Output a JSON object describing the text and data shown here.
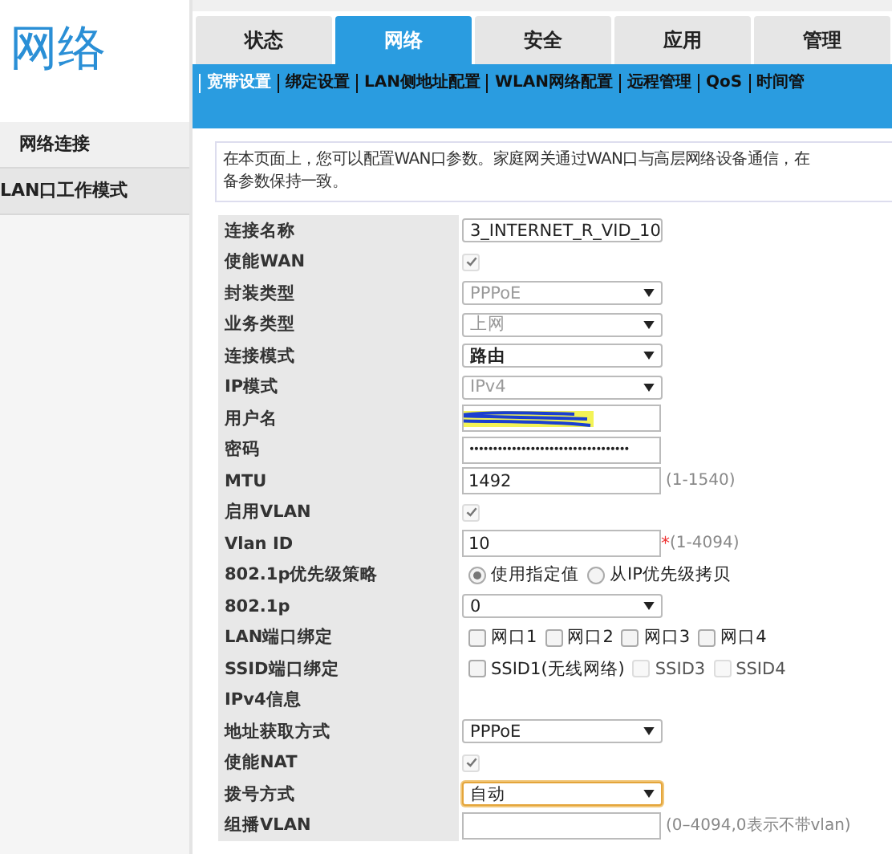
{
  "sidebar": {
    "title": "网络",
    "items": [
      {
        "label": "网络连接",
        "selected": true
      },
      {
        "label": "LAN口工作模式",
        "selected": false
      }
    ]
  },
  "tabs": [
    {
      "label": "状态",
      "selected": false
    },
    {
      "label": "网络",
      "selected": true
    },
    {
      "label": "安全",
      "selected": false
    },
    {
      "label": "应用",
      "selected": false
    },
    {
      "label": "管理",
      "selected": false
    }
  ],
  "subnav": [
    {
      "label": "宽带设置",
      "selected": true
    },
    {
      "label": "绑定设置",
      "selected": false
    },
    {
      "label": "LAN侧地址配置",
      "selected": false
    },
    {
      "label": "WLAN网络配置",
      "selected": false
    },
    {
      "label": "远程管理",
      "selected": false
    },
    {
      "label": "QoS",
      "selected": false
    },
    {
      "label": "时间管",
      "selected": false
    }
  ],
  "description": [
    "在本页面上，您可以配置WAN口参数。家庭网关通过WAN口与高层网络设备通信，在",
    "备参数保持一致。"
  ],
  "form": [
    {
      "label": "连接名称",
      "kind": "select",
      "value": "3_INTERNET_R_VID_10",
      "disabled": false
    },
    {
      "label": "使能WAN",
      "kind": "checkbox",
      "checked": true,
      "disabled": true
    },
    {
      "label": "封装类型",
      "kind": "select",
      "value": "PPPoE",
      "disabled": true
    },
    {
      "label": "业务类型",
      "kind": "select",
      "value": "上网",
      "disabled": true
    },
    {
      "label": "连接模式",
      "kind": "select",
      "value": "路由",
      "disabled": false
    },
    {
      "label": "IP模式",
      "kind": "select",
      "value": "IPv4",
      "disabled": true
    },
    {
      "label": "用户名",
      "kind": "text",
      "redacted": true
    },
    {
      "label": "密码",
      "kind": "text",
      "value": "••••••••••••••••••••••••••••••••••"
    },
    {
      "label": "MTU",
      "kind": "text",
      "value": "1492",
      "hint": "(1-1540)"
    },
    {
      "label": "启用VLAN",
      "kind": "checkbox",
      "checked": true,
      "disabled": true
    },
    {
      "label": "Vlan ID",
      "kind": "text",
      "value": "10",
      "required_mark": "*",
      "hint": "(1-4094)"
    },
    {
      "label": "802.1p优先级策略",
      "kind": "radio",
      "options": [
        {
          "label": "使用指定值",
          "selected": true
        },
        {
          "label": "从IP优先级拷贝",
          "selected": false
        }
      ]
    },
    {
      "label": "802.1p",
      "kind": "select",
      "value": "0",
      "disabled": false
    },
    {
      "label": "LAN端口绑定",
      "kind": "checkboxes",
      "options": [
        {
          "label": "网口1",
          "checked": false,
          "disabled": false
        },
        {
          "label": "网口2",
          "checked": false,
          "disabled": false
        },
        {
          "label": "网口3",
          "checked": false,
          "disabled": false
        },
        {
          "label": "网口4",
          "checked": false,
          "disabled": false
        }
      ]
    },
    {
      "label": "SSID端口绑定",
      "kind": "checkboxes",
      "options": [
        {
          "label": "SSID1(无线网络)",
          "checked": false,
          "disabled": false
        },
        {
          "label": "SSID3",
          "checked": false,
          "disabled": true
        },
        {
          "label": "SSID4",
          "checked": false,
          "disabled": true
        }
      ]
    },
    {
      "label": "IPv4信息",
      "kind": "heading"
    },
    {
      "label": "地址获取方式",
      "kind": "select",
      "value": "PPPoE",
      "disabled": false
    },
    {
      "label": "使能NAT",
      "kind": "checkbox",
      "checked": true,
      "disabled": true
    },
    {
      "label": "拨号方式",
      "kind": "select",
      "value": "自动",
      "disabled": false,
      "focused": true
    },
    {
      "label": "组播VLAN",
      "kind": "text",
      "hint": "(0–4094,0表示不带vlan)"
    }
  ]
}
